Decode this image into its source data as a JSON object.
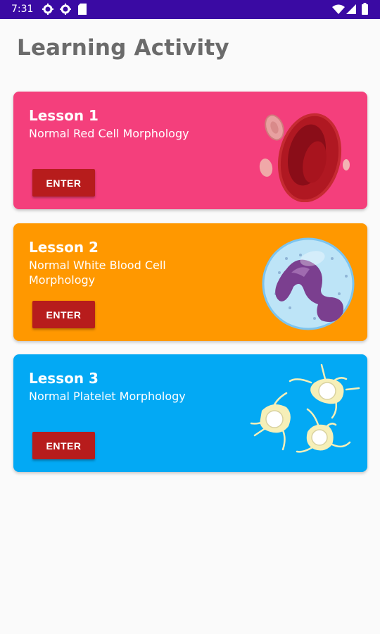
{
  "status_bar": {
    "time": "7:31",
    "left_icons": [
      "gear-icon",
      "gear-icon",
      "sd-card-icon"
    ],
    "right_icons": [
      "wifi-icon",
      "signal-icon",
      "battery-icon"
    ]
  },
  "page": {
    "title": "Learning Activity"
  },
  "colors": {
    "status_bar": "#3a0aa3",
    "lesson1": "#f43f7c",
    "lesson2": "#ff9800",
    "lesson3": "#03a9f4",
    "enter_button": "#b71c1c"
  },
  "lessons": [
    {
      "title": "Lesson 1",
      "subtitle": "Normal Red Cell Morphology",
      "button": "ENTER",
      "illustration": "red-blood-cell-icon"
    },
    {
      "title": "Lesson 2",
      "subtitle": "Normal White Blood Cell Morphology",
      "button": "ENTER",
      "illustration": "white-blood-cell-icon"
    },
    {
      "title": "Lesson 3",
      "subtitle": "Normal Platelet Morphology",
      "button": "ENTER",
      "illustration": "platelet-icon"
    }
  ]
}
